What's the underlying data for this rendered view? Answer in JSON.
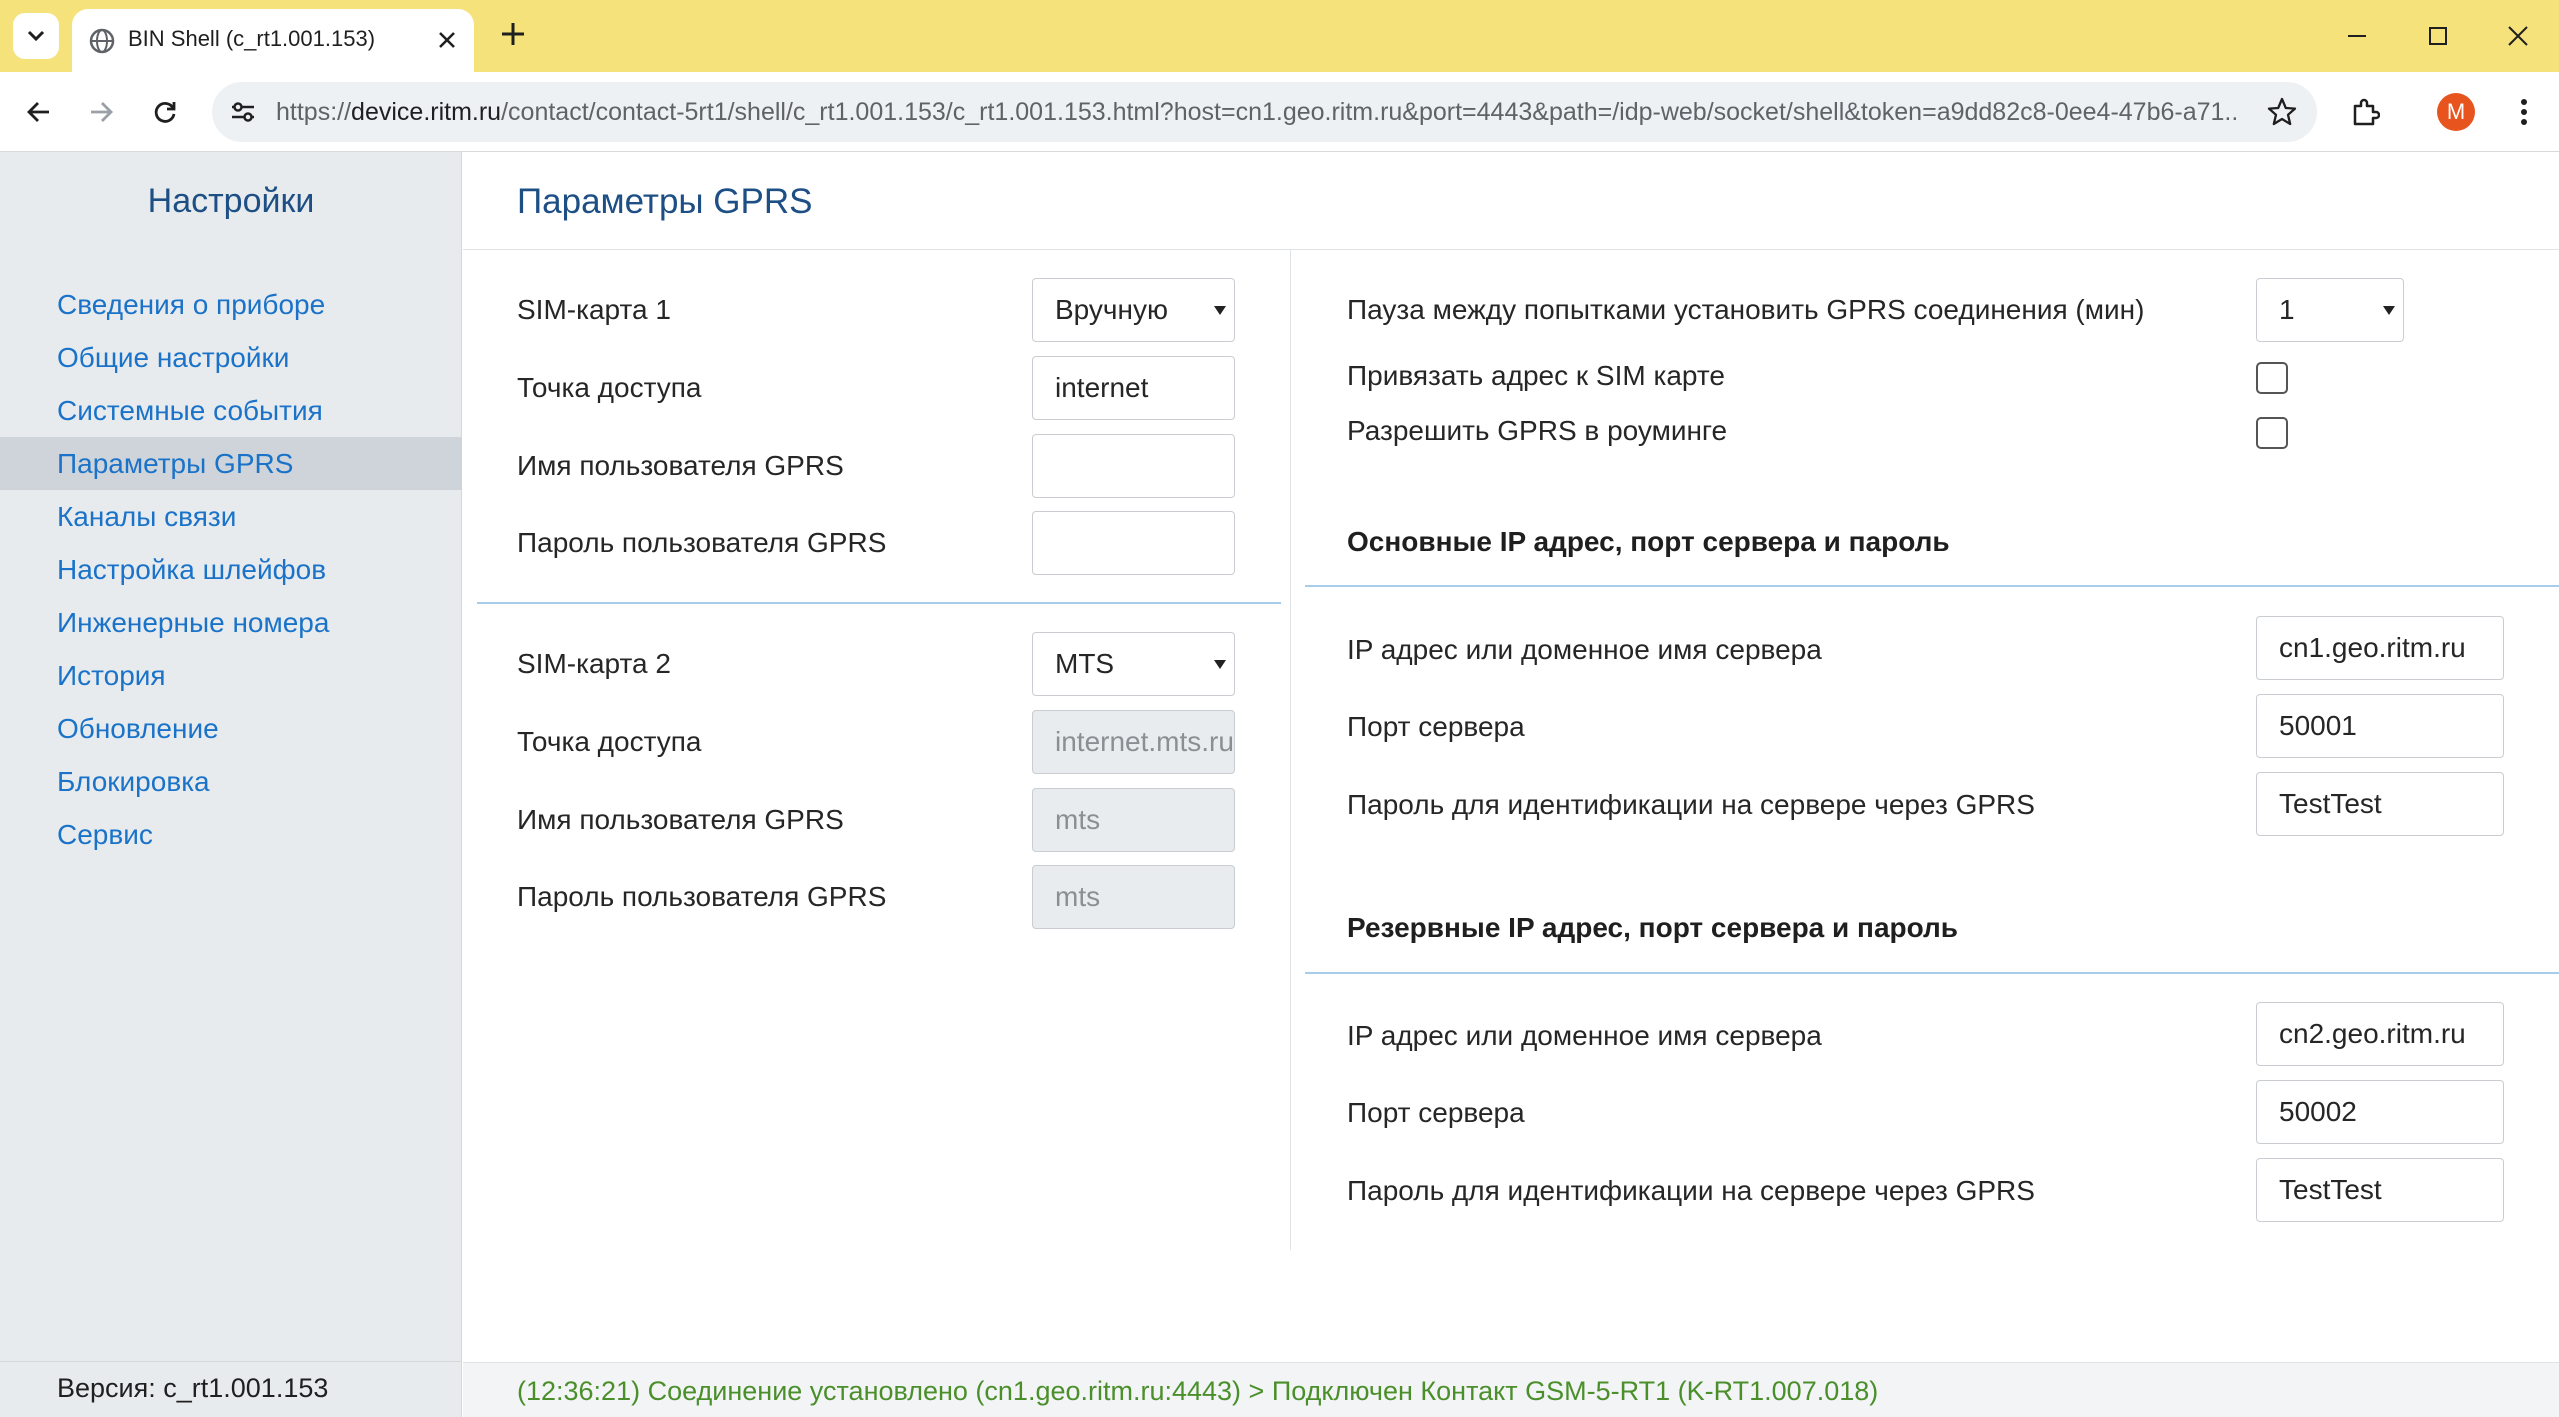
{
  "browser": {
    "tab_title": "BIN Shell (c_rt1.001.153)",
    "url_prefix": "https://",
    "url_host": "device.ritm.ru",
    "url_path": "/contact/contact-5rt1/shell/c_rt1.001.153/c_rt1.001.153.html?host=cn1.geo.ritm.ru&port=4443&path=/idp-web/socket/shell&token=a9dd82c8-0ee4-47b6-a71...",
    "profile_initial": "M"
  },
  "sidebar": {
    "title": "Настройки",
    "items": [
      {
        "label": "Сведения о приборе"
      },
      {
        "label": "Общие настройки"
      },
      {
        "label": "Системные события"
      },
      {
        "label": "Параметры GPRS"
      },
      {
        "label": "Каналы связи"
      },
      {
        "label": "Настройка шлейфов"
      },
      {
        "label": "Инженерные номера"
      },
      {
        "label": "История"
      },
      {
        "label": "Обновление"
      },
      {
        "label": "Блокировка"
      },
      {
        "label": "Сервис"
      }
    ],
    "active_item": "Параметры GPRS",
    "version": "Версия: c_rt1.001.153"
  },
  "main": {
    "title": "Параметры GPRS",
    "sim1": {
      "sim_label": "SIM-карта 1",
      "sim_value": "Вручную",
      "apn_label": "Точка доступа",
      "apn_value": "internet",
      "user_label": "Имя пользователя GPRS",
      "user_value": "",
      "pass_label": "Пароль пользователя GPRS",
      "pass_value": ""
    },
    "sim2": {
      "sim_label": "SIM-карта 2",
      "sim_value": "MTS",
      "apn_label": "Точка доступа",
      "apn_value": "internet.mts.ru",
      "user_label": "Имя пользователя GPRS",
      "user_value": "mts",
      "pass_label": "Пароль пользователя GPRS",
      "pass_value": "mts"
    },
    "right": {
      "pause_label": "Пауза между попытками установить GPRS соединения (мин)",
      "pause_value": "1",
      "bind_label": "Привязать адрес к SIM карте",
      "bind_checked": false,
      "roaming_label": "Разрешить GPRS в роуминге",
      "roaming_checked": false
    },
    "primary": {
      "heading": "Основные IP адрес, порт сервера и пароль",
      "ip_label": "IP адрес или доменное имя сервера",
      "ip_value": "cn1.geo.ritm.ru",
      "port_label": "Порт сервера",
      "port_value": "50001",
      "pass_label": "Пароль для идентификации на сервере через GPRS",
      "pass_value": "TestTest"
    },
    "backup": {
      "heading": "Резервные IP адрес, порт сервера и пароль",
      "ip_label": "IP адрес или доменное имя сервера",
      "ip_value": "cn2.geo.ritm.ru",
      "port_label": "Порт сервера",
      "port_value": "50002",
      "pass_label": "Пароль для идентификации на сервере через GPRS",
      "pass_value": "TestTest"
    }
  },
  "status": {
    "text": "(12:36:21) Соединение установлено (cn1.geo.ritm.ru:4443) > Подключен Контакт GSM-5-RT1 (K-RT1.007.018)"
  }
}
